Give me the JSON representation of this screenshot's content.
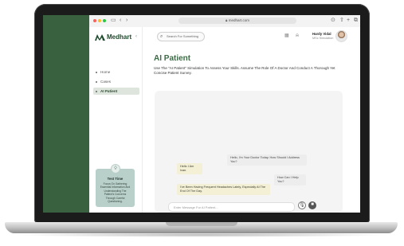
{
  "browser": {
    "url": "medhart.com",
    "dot_colors": [
      "#ff5f57",
      "#febc2e",
      "#28c840"
    ]
  },
  "brand": {
    "name": "Medhart",
    "color": "#1e4a2b"
  },
  "sidebar": {
    "items": [
      {
        "label": "Home",
        "icon": "dot-icon"
      },
      {
        "label": "Cases",
        "icon": "dot-icon"
      },
      {
        "label": "AI Patient",
        "icon": "dot-icon",
        "active": true
      }
    ],
    "tip": {
      "title": "Test Time",
      "body": "Focus On Gathering Essential Information And Understanding The Patient's Concerns Through Careful Questioning."
    }
  },
  "header": {
    "search_placeholder": "Search For Something",
    "user": {
      "name": "Hardy Vidal",
      "role": "MSc Simulation"
    }
  },
  "main": {
    "title": "AI Patient",
    "description": "Use The \"AI Patient\" Simulation To Assess Your Skills. Assume The Role Of A Doctor And Conduct A Thorough Yet Concise Patient Survey."
  },
  "chat": {
    "messages": [
      {
        "role": "user",
        "text": "Hello, I'm Your Doctor Today. How Should I Address You?"
      },
      {
        "role": "ai",
        "text": "Hello I Am Ivan."
      },
      {
        "role": "user",
        "text": "How Can I Help You?"
      },
      {
        "role": "ai",
        "text": "I've Been Having Frequent Headaches Lately, Especially At The End Of The Day."
      }
    ],
    "input_placeholder": "Enter Message For AI Patient..."
  },
  "colors": {
    "accent": "#3c6b45",
    "sidebar_green": "#39613f",
    "ai_bubble": "#f3f0d6",
    "tip_card": "#b9cfc9"
  }
}
